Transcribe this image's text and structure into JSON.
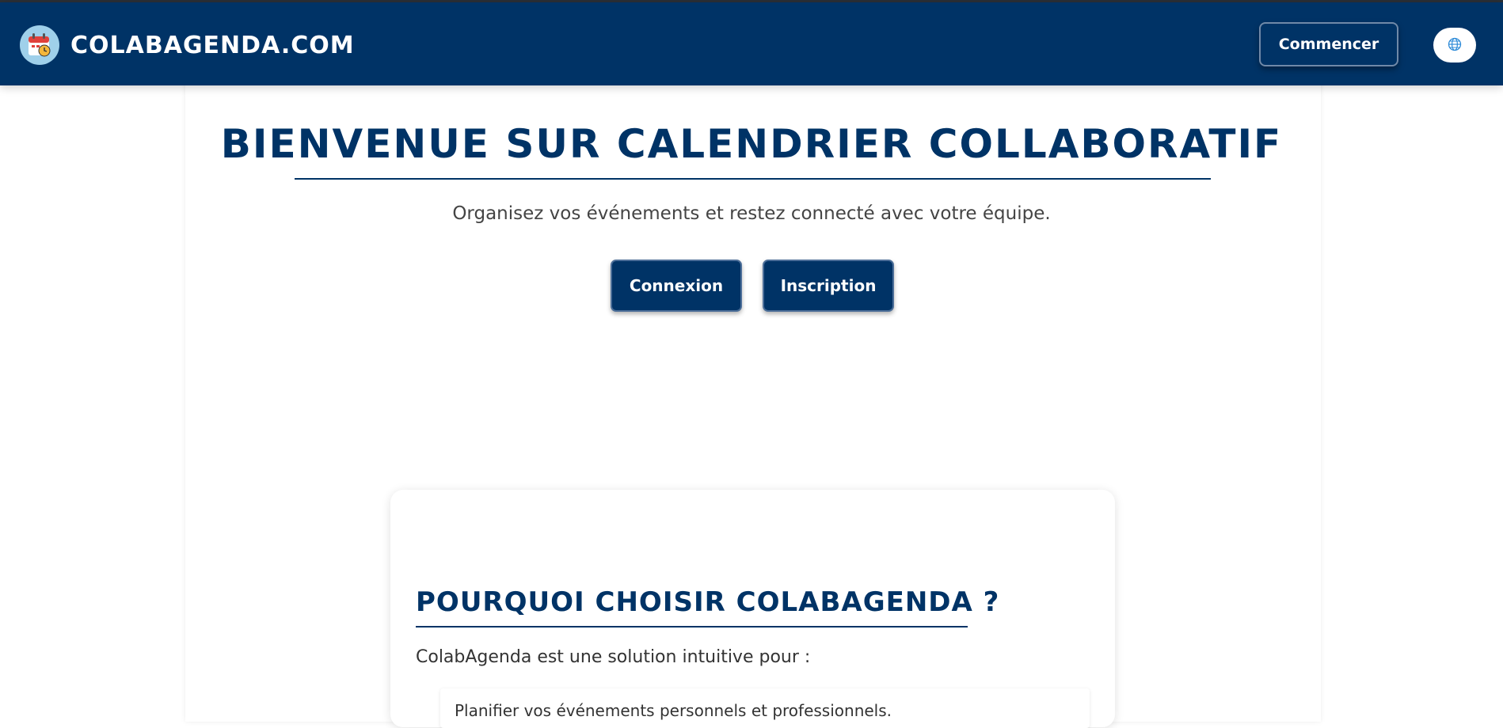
{
  "header": {
    "brand": "COLABAGENDA.COM",
    "start_button": "Commencer",
    "logo_icon": "calendar-clock-icon",
    "language_icon": "globe-icon",
    "bar_color": "#003366"
  },
  "hero": {
    "title": "BIENVENUE SUR CALENDRIER COLLABORATIF",
    "subtitle": "Organisez vos événements et restez connecté avec votre équipe.",
    "login_button": "Connexion",
    "register_button": "Inscription"
  },
  "why": {
    "title": "POURQUOI CHOISIR COLABAGENDA ?",
    "intro": "ColabAgenda est une solution intuitive pour :",
    "items": [
      "Planifier vos événements personnels et professionnels."
    ]
  }
}
